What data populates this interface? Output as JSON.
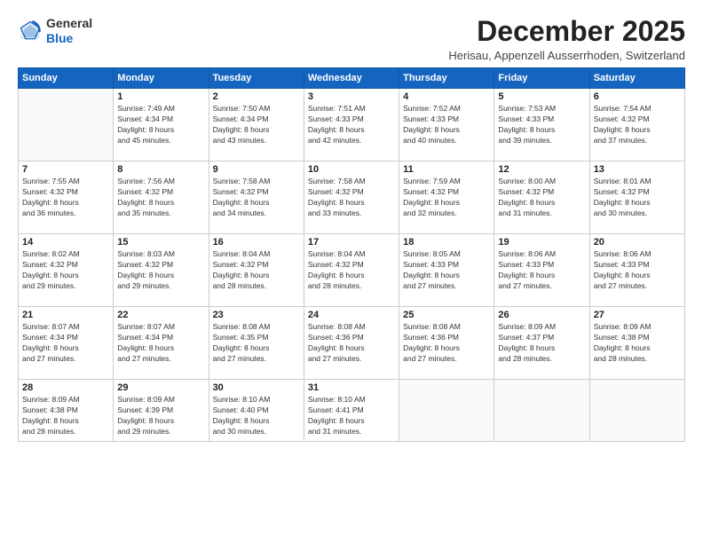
{
  "logo": {
    "general": "General",
    "blue": "Blue"
  },
  "title": "December 2025",
  "subtitle": "Herisau, Appenzell Ausserrhoden, Switzerland",
  "days_of_week": [
    "Sunday",
    "Monday",
    "Tuesday",
    "Wednesday",
    "Thursday",
    "Friday",
    "Saturday"
  ],
  "weeks": [
    [
      {
        "day": "",
        "info": ""
      },
      {
        "day": "1",
        "info": "Sunrise: 7:49 AM\nSunset: 4:34 PM\nDaylight: 8 hours\nand 45 minutes."
      },
      {
        "day": "2",
        "info": "Sunrise: 7:50 AM\nSunset: 4:34 PM\nDaylight: 8 hours\nand 43 minutes."
      },
      {
        "day": "3",
        "info": "Sunrise: 7:51 AM\nSunset: 4:33 PM\nDaylight: 8 hours\nand 42 minutes."
      },
      {
        "day": "4",
        "info": "Sunrise: 7:52 AM\nSunset: 4:33 PM\nDaylight: 8 hours\nand 40 minutes."
      },
      {
        "day": "5",
        "info": "Sunrise: 7:53 AM\nSunset: 4:33 PM\nDaylight: 8 hours\nand 39 minutes."
      },
      {
        "day": "6",
        "info": "Sunrise: 7:54 AM\nSunset: 4:32 PM\nDaylight: 8 hours\nand 37 minutes."
      }
    ],
    [
      {
        "day": "7",
        "info": "Sunrise: 7:55 AM\nSunset: 4:32 PM\nDaylight: 8 hours\nand 36 minutes."
      },
      {
        "day": "8",
        "info": "Sunrise: 7:56 AM\nSunset: 4:32 PM\nDaylight: 8 hours\nand 35 minutes."
      },
      {
        "day": "9",
        "info": "Sunrise: 7:58 AM\nSunset: 4:32 PM\nDaylight: 8 hours\nand 34 minutes."
      },
      {
        "day": "10",
        "info": "Sunrise: 7:58 AM\nSunset: 4:32 PM\nDaylight: 8 hours\nand 33 minutes."
      },
      {
        "day": "11",
        "info": "Sunrise: 7:59 AM\nSunset: 4:32 PM\nDaylight: 8 hours\nand 32 minutes."
      },
      {
        "day": "12",
        "info": "Sunrise: 8:00 AM\nSunset: 4:32 PM\nDaylight: 8 hours\nand 31 minutes."
      },
      {
        "day": "13",
        "info": "Sunrise: 8:01 AM\nSunset: 4:32 PM\nDaylight: 8 hours\nand 30 minutes."
      }
    ],
    [
      {
        "day": "14",
        "info": "Sunrise: 8:02 AM\nSunset: 4:32 PM\nDaylight: 8 hours\nand 29 minutes."
      },
      {
        "day": "15",
        "info": "Sunrise: 8:03 AM\nSunset: 4:32 PM\nDaylight: 8 hours\nand 29 minutes."
      },
      {
        "day": "16",
        "info": "Sunrise: 8:04 AM\nSunset: 4:32 PM\nDaylight: 8 hours\nand 28 minutes."
      },
      {
        "day": "17",
        "info": "Sunrise: 8:04 AM\nSunset: 4:32 PM\nDaylight: 8 hours\nand 28 minutes."
      },
      {
        "day": "18",
        "info": "Sunrise: 8:05 AM\nSunset: 4:33 PM\nDaylight: 8 hours\nand 27 minutes."
      },
      {
        "day": "19",
        "info": "Sunrise: 8:06 AM\nSunset: 4:33 PM\nDaylight: 8 hours\nand 27 minutes."
      },
      {
        "day": "20",
        "info": "Sunrise: 8:06 AM\nSunset: 4:33 PM\nDaylight: 8 hours\nand 27 minutes."
      }
    ],
    [
      {
        "day": "21",
        "info": "Sunrise: 8:07 AM\nSunset: 4:34 PM\nDaylight: 8 hours\nand 27 minutes."
      },
      {
        "day": "22",
        "info": "Sunrise: 8:07 AM\nSunset: 4:34 PM\nDaylight: 8 hours\nand 27 minutes."
      },
      {
        "day": "23",
        "info": "Sunrise: 8:08 AM\nSunset: 4:35 PM\nDaylight: 8 hours\nand 27 minutes."
      },
      {
        "day": "24",
        "info": "Sunrise: 8:08 AM\nSunset: 4:36 PM\nDaylight: 8 hours\nand 27 minutes."
      },
      {
        "day": "25",
        "info": "Sunrise: 8:08 AM\nSunset: 4:36 PM\nDaylight: 8 hours\nand 27 minutes."
      },
      {
        "day": "26",
        "info": "Sunrise: 8:09 AM\nSunset: 4:37 PM\nDaylight: 8 hours\nand 28 minutes."
      },
      {
        "day": "27",
        "info": "Sunrise: 8:09 AM\nSunset: 4:38 PM\nDaylight: 8 hours\nand 28 minutes."
      }
    ],
    [
      {
        "day": "28",
        "info": "Sunrise: 8:09 AM\nSunset: 4:38 PM\nDaylight: 8 hours\nand 28 minutes."
      },
      {
        "day": "29",
        "info": "Sunrise: 8:09 AM\nSunset: 4:39 PM\nDaylight: 8 hours\nand 29 minutes."
      },
      {
        "day": "30",
        "info": "Sunrise: 8:10 AM\nSunset: 4:40 PM\nDaylight: 8 hours\nand 30 minutes."
      },
      {
        "day": "31",
        "info": "Sunrise: 8:10 AM\nSunset: 4:41 PM\nDaylight: 8 hours\nand 31 minutes."
      },
      {
        "day": "",
        "info": ""
      },
      {
        "day": "",
        "info": ""
      },
      {
        "day": "",
        "info": ""
      }
    ]
  ]
}
